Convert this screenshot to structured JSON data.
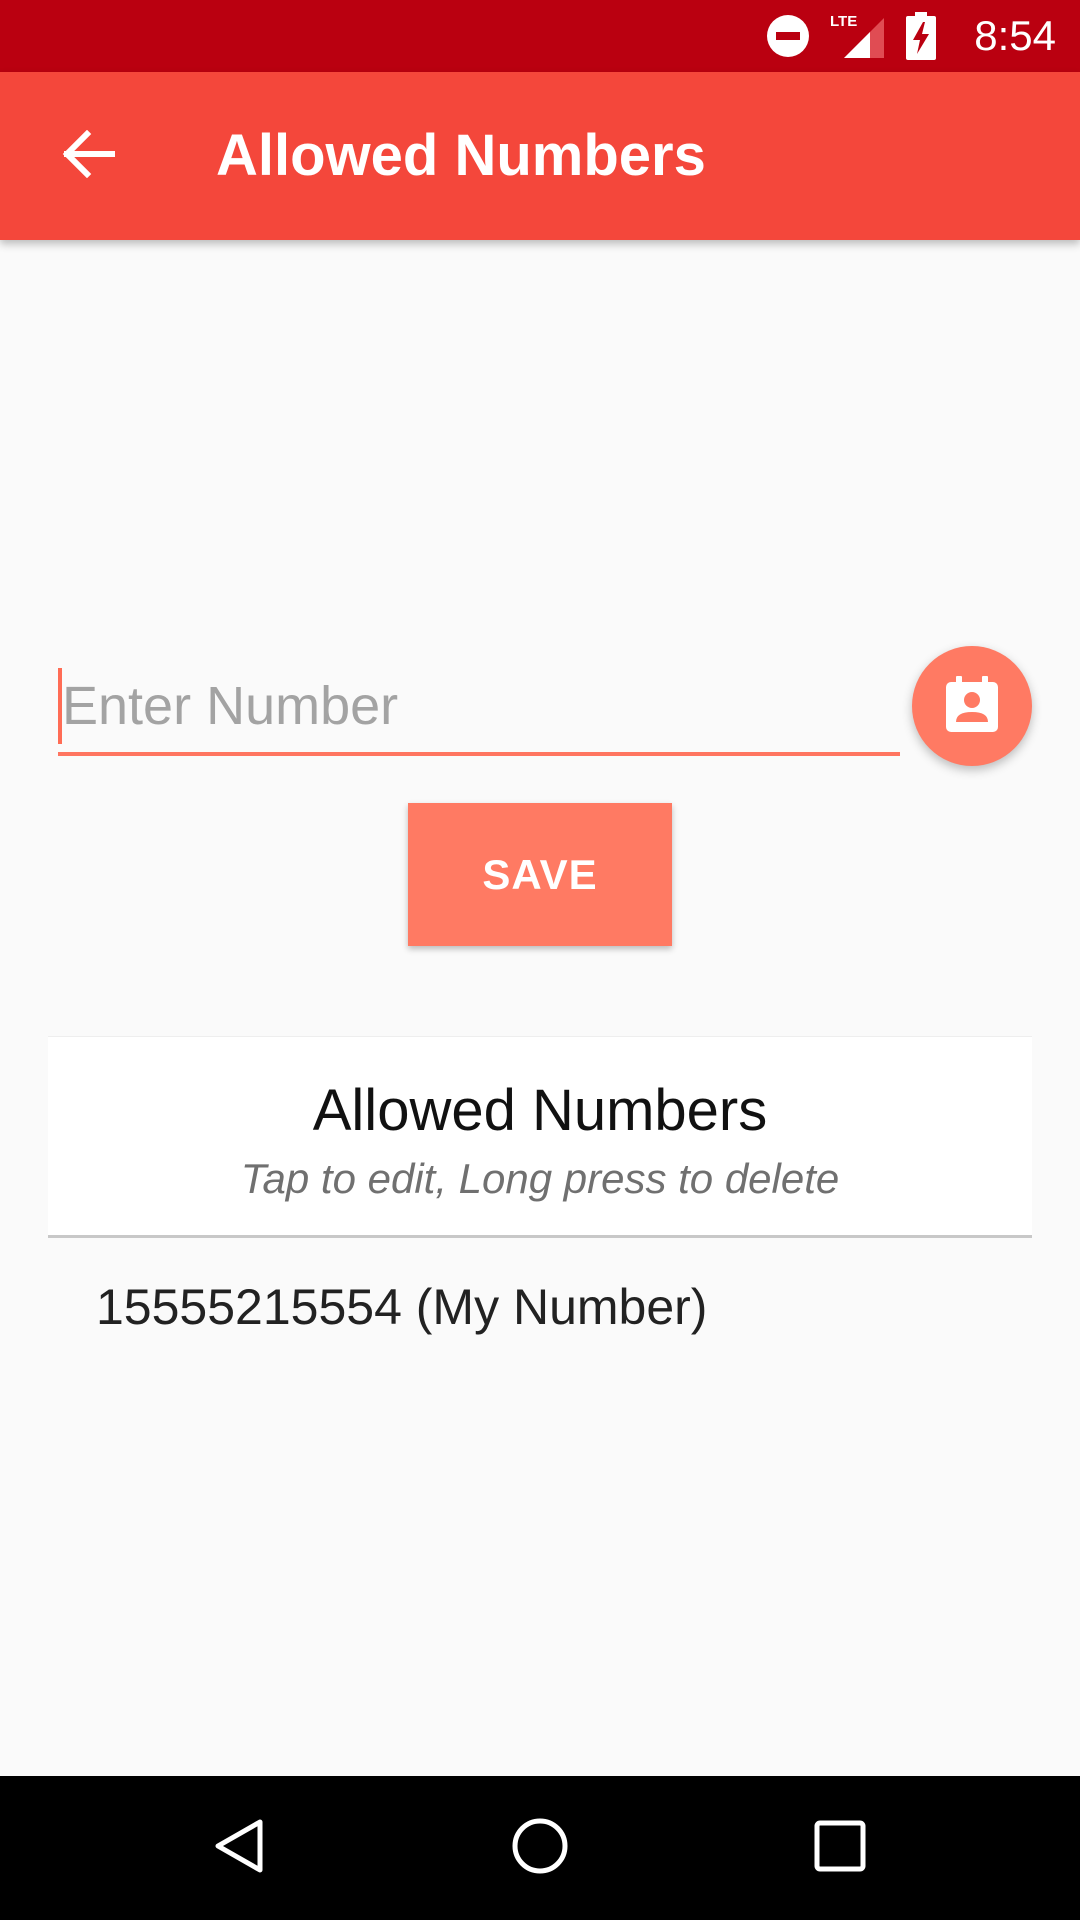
{
  "status_bar": {
    "time": "8:54",
    "network_label": "LTE",
    "icons": [
      "do-not-disturb-icon",
      "signal-icon",
      "battery-charging-icon"
    ],
    "color": "#ba0010"
  },
  "app_bar": {
    "title": "Allowed Numbers",
    "back_icon": "arrow-back-icon",
    "color": "#f4473b"
  },
  "form": {
    "input_placeholder": "Enter Number",
    "input_value": "",
    "contacts_icon": "contacts-icon",
    "save_label": "SAVE",
    "accent_color": "#ff7a63"
  },
  "list": {
    "title": "Allowed Numbers",
    "subtitle": "Tap to edit, Long press to delete",
    "items": [
      {
        "label": "15555215554 (My Number)"
      }
    ]
  },
  "nav_bar": {
    "icons": [
      "back-triangle-icon",
      "home-circle-icon",
      "recents-square-icon"
    ]
  }
}
